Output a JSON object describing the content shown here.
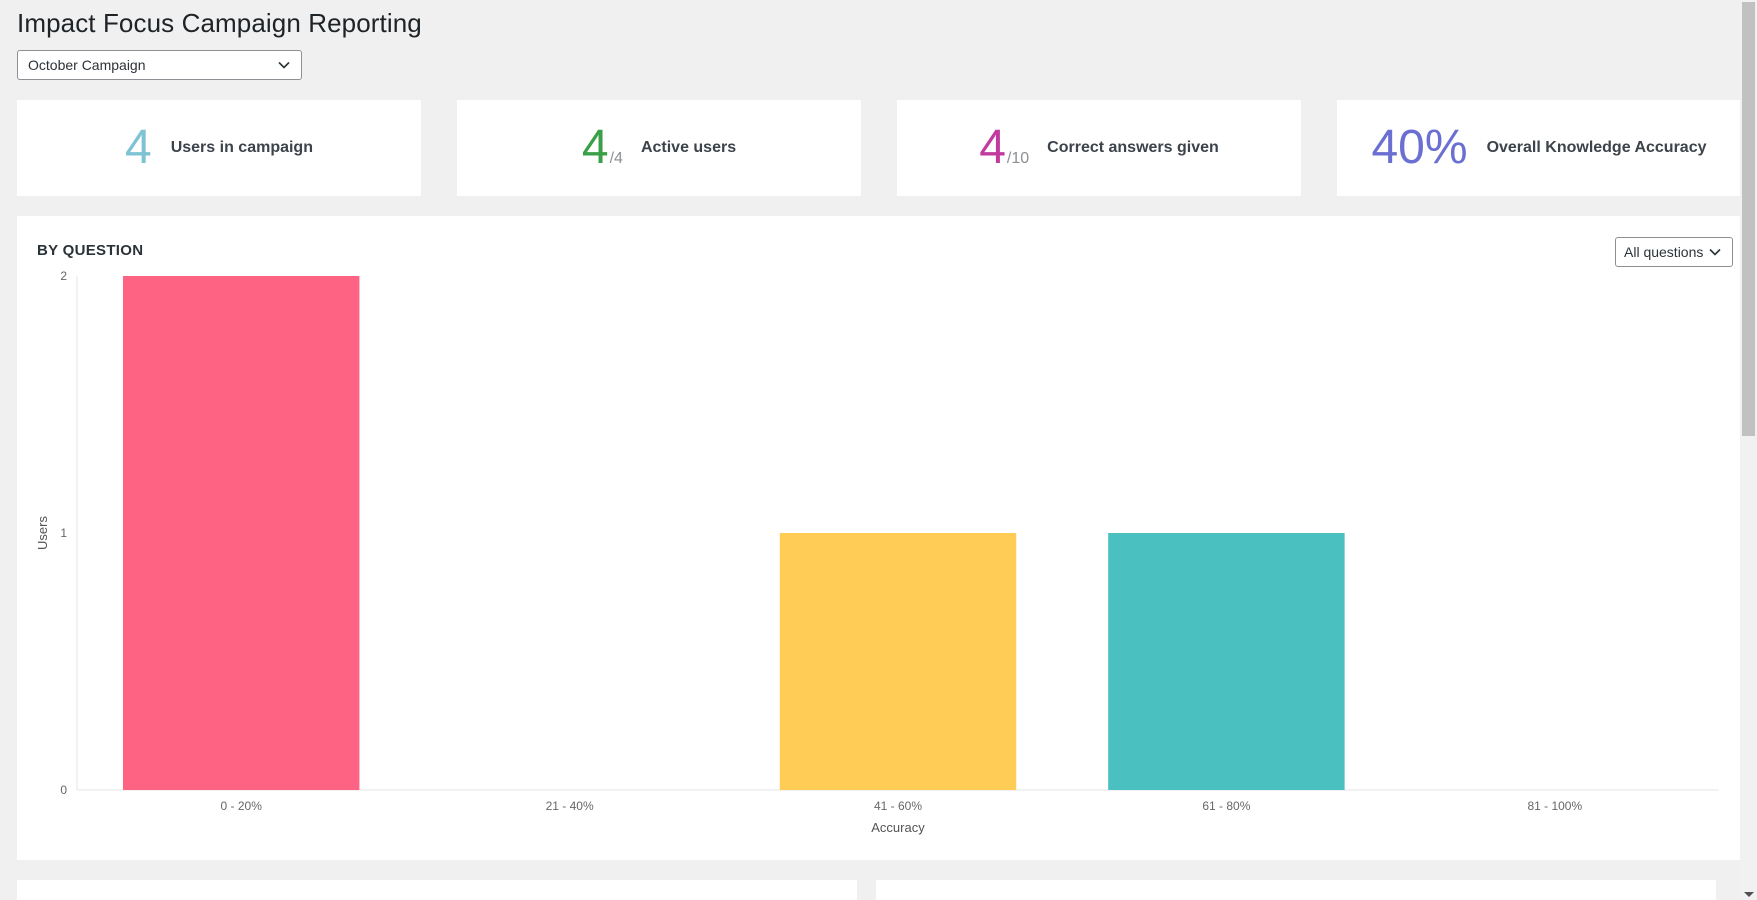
{
  "page": {
    "title": "Impact Focus Campaign Reporting"
  },
  "campaign_select": {
    "value": "October Campaign"
  },
  "stats": [
    {
      "value": "4",
      "sub": "",
      "label": "Users in campaign",
      "color": "#7ec3d4"
    },
    {
      "value": "4",
      "sub": "/4",
      "label": "Active users",
      "color": "#3aa048"
    },
    {
      "value": "4",
      "sub": "/10",
      "label": "Correct answers given",
      "color": "#c23a9e"
    },
    {
      "value": "40%",
      "sub": "",
      "label": "Overall Knowledge Accuracy",
      "color": "#6a6fd1"
    }
  ],
  "by_question": {
    "title": "BY QUESTION",
    "filter_value": "All questions"
  },
  "chart_data": {
    "type": "bar",
    "categories": [
      "0 - 20%",
      "21 - 40%",
      "41 - 60%",
      "61 - 80%",
      "81 - 100%"
    ],
    "values": [
      2,
      0,
      1,
      1,
      0
    ],
    "colors": [
      "#ff6384",
      "#ff9f40",
      "#ffcd56",
      "#4bc0c0",
      "#36a2eb"
    ],
    "xlabel": "Accuracy",
    "ylabel": "Users",
    "ylim": [
      0,
      2
    ],
    "yticks": [
      0,
      1,
      2
    ],
    "grid": false,
    "legend": "none"
  }
}
